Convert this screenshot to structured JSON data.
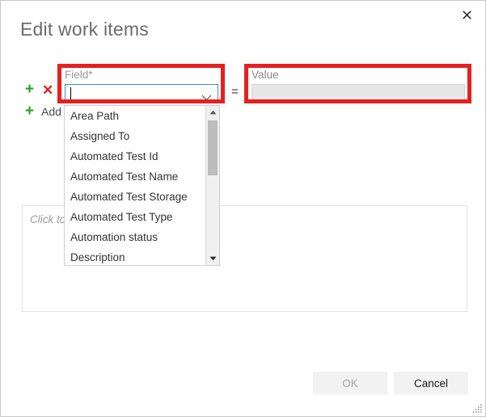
{
  "window": {
    "title": "Edit work items",
    "close_icon": "close-icon",
    "resize_grip_icon": "resize-grip-icon"
  },
  "row_controls": {
    "add_row_icon": "plus-icon",
    "remove_row_icon": "cross-icon",
    "add_new_icon": "plus-icon",
    "add_label": "Add"
  },
  "field": {
    "label": "Field*",
    "value": "",
    "placeholder": "",
    "chevron_icon": "chevron-down-icon",
    "focus_border_color": "#3a8dde"
  },
  "operator": {
    "symbol": "="
  },
  "value": {
    "label": "Value",
    "value": "",
    "disabled": true,
    "background_color": "#e7e7e7"
  },
  "comment_area": {
    "placeholder": "Click to"
  },
  "dropdown": {
    "items": [
      "Area Path",
      "Assigned To",
      "Automated Test Id",
      "Automated Test Name",
      "Automated Test Storage",
      "Automated Test Type",
      "Automation status",
      "Description"
    ],
    "scroll_up_icon": "triangle-up-icon",
    "scroll_down_icon": "triangle-down-icon",
    "thumb_position_percent": 0,
    "thumb_size_percent": 37
  },
  "footer": {
    "ok_label": "OK",
    "ok_disabled": true,
    "cancel_label": "Cancel"
  },
  "highlights": {
    "color": "#e52020",
    "field_box": "field-highlight",
    "value_box": "value-highlight"
  }
}
